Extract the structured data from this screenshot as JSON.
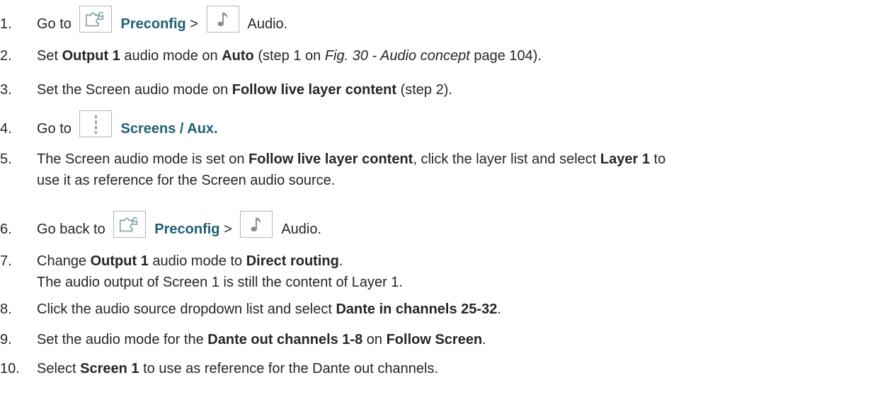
{
  "steps": [
    {
      "num": "1.",
      "parts": [
        {
          "t": "Go to "
        },
        {
          "icon": "puzzle-icon"
        },
        {
          "t": "Preconfig",
          "s": "link"
        },
        {
          "t": " > "
        },
        {
          "icon": "music-note-icon"
        },
        {
          "t": "Audio."
        }
      ]
    },
    {
      "num": "2.",
      "parts": [
        {
          "t": "Set "
        },
        {
          "t": "Output 1",
          "s": "bold"
        },
        {
          "t": " audio mode on "
        },
        {
          "t": "Auto",
          "s": "bold"
        },
        {
          "t": " (step 1 on "
        },
        {
          "t": "Fig. 30 - Audio concept",
          "s": "ital"
        },
        {
          "t": " page 104)."
        }
      ]
    },
    {
      "num": "3.",
      "parts": [
        {
          "t": "Set the Screen audio mode on "
        },
        {
          "t": "Follow live layer content",
          "s": "bold"
        },
        {
          "t": " (step 2)."
        }
      ]
    },
    {
      "num": "4.",
      "parts": [
        {
          "t": "Go to "
        },
        {
          "icon": "screens-icon"
        },
        {
          "t": "Screens / Aux.",
          "s": "link"
        }
      ]
    },
    {
      "num": "5.",
      "parts": [
        {
          "t": "The Screen audio mode is set on "
        },
        {
          "t": "Follow live layer content",
          "s": "bold"
        },
        {
          "t": ", click the layer list and select "
        },
        {
          "t": "Layer 1",
          "s": "bold"
        },
        {
          "t": " to"
        }
      ],
      "line2": "use it as reference for the Screen audio source."
    },
    {
      "num": "6.",
      "parts": [
        {
          "t": "Go back to "
        },
        {
          "icon": "puzzle-icon"
        },
        {
          "t": "Preconfig",
          "s": "link"
        },
        {
          "t": " > "
        },
        {
          "icon": "music-note-icon"
        },
        {
          "t": "Audio."
        }
      ]
    },
    {
      "num": "7.",
      "parts": [
        {
          "t": "Change "
        },
        {
          "t": "Output 1",
          "s": "bold"
        },
        {
          "t": " audio mode to "
        },
        {
          "t": "Direct routing",
          "s": "bold"
        },
        {
          "t": "."
        }
      ],
      "line2": "The audio output of Screen 1 is still the content of Layer 1."
    },
    {
      "num": "8.",
      "parts": [
        {
          "t": "Click the audio source dropdown list and select "
        },
        {
          "t": "Dante in channels 25-32",
          "s": "bold"
        },
        {
          "t": "."
        }
      ]
    },
    {
      "num": "9.",
      "parts": [
        {
          "t": "Set the audio mode for the "
        },
        {
          "t": "Dante out channels 1-8",
          "s": "bold"
        },
        {
          "t": " on "
        },
        {
          "t": "Follow Screen",
          "s": "bold"
        },
        {
          "t": "."
        }
      ]
    },
    {
      "num": "10.",
      "parts": [
        {
          "t": "Select "
        },
        {
          "t": "Screen 1",
          "s": "bold"
        },
        {
          "t": " to use as reference for the Dante out channels."
        }
      ]
    }
  ],
  "colors": {
    "text": "#262626",
    "link": "#1f5f73",
    "icon_border": "#b5b5b5"
  }
}
